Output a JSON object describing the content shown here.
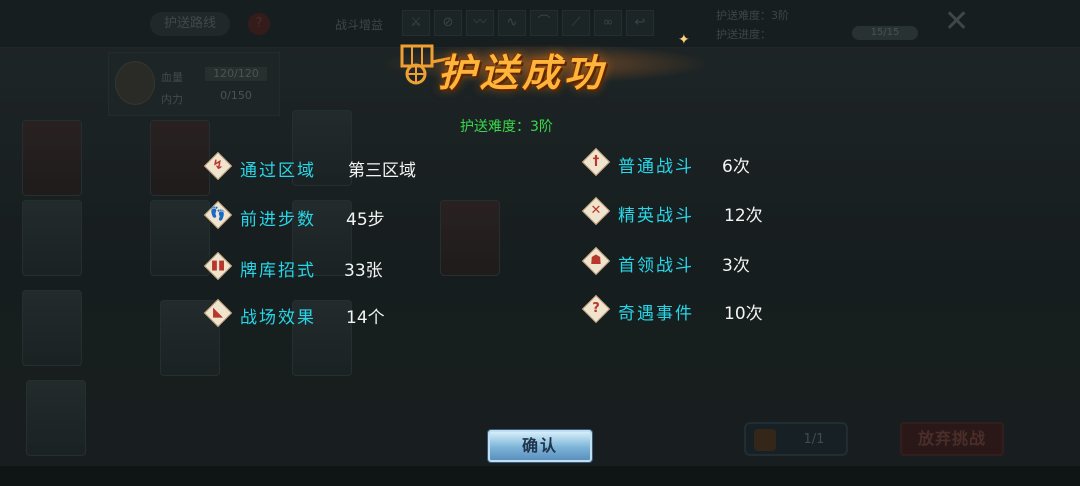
{
  "background": {
    "route_button": "护送路线",
    "help_glyph": "?",
    "battle_buff_label": "战斗增益",
    "buff_icons": [
      "sword-icon",
      "slash-icon",
      "claw-icon",
      "whip-icon",
      "bow-icon",
      "dagger-icon",
      "chain-icon",
      "hook-icon"
    ],
    "escort_difficulty_label": "护送难度：",
    "escort_difficulty_value": "3阶",
    "escort_progress_label": "护送进度：",
    "escort_progress_value": "15/15",
    "hero": {
      "hp_label": "血量",
      "hp_value": "120/120",
      "mp_label": "内力",
      "mp_value": "0/150"
    },
    "card_count": "1/1",
    "give_up_button": "放弃挑战"
  },
  "result": {
    "title": "护送成功",
    "difficulty_label": "护送难度：",
    "difficulty_value": "3阶",
    "left_stats": [
      {
        "label": "通过区域",
        "value": "第三区域",
        "icon": "route-icon"
      },
      {
        "label": "前进步数",
        "value": "45步",
        "icon": "footprints-icon"
      },
      {
        "label": "牌库招式",
        "value": "33张",
        "icon": "cards-icon"
      },
      {
        "label": "战场效果",
        "value": "14个",
        "icon": "horn-icon"
      }
    ],
    "right_stats": [
      {
        "label": "普通战斗",
        "value": "6次",
        "icon": "sword-icon"
      },
      {
        "label": "精英战斗",
        "value": "12次",
        "icon": "crossed-swords-icon"
      },
      {
        "label": "首领战斗",
        "value": "3次",
        "icon": "demon-mask-icon"
      },
      {
        "label": "奇遇事件",
        "value": "10次",
        "icon": "question-icon"
      }
    ],
    "confirm_button": "确认"
  },
  "colors": {
    "stat_label": "#27d6e8",
    "stat_value": "#f3f3f3",
    "difficulty_text": "#39d84a",
    "title_gold": "#ffb43a"
  }
}
